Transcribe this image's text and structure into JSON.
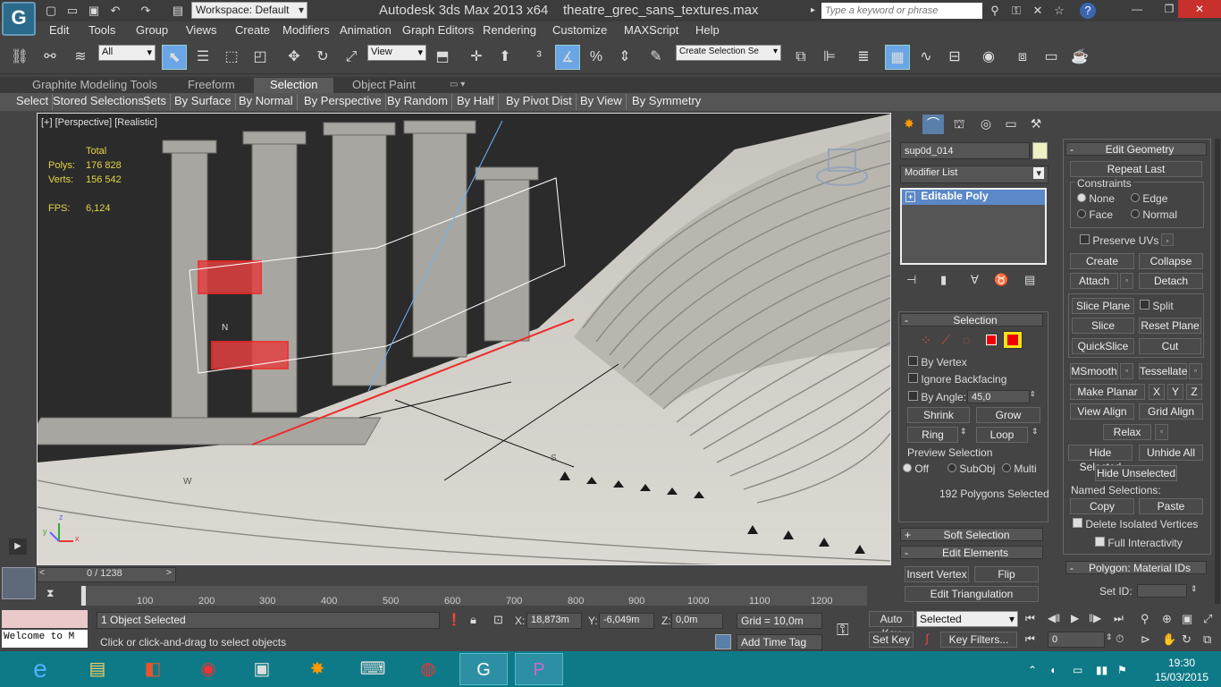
{
  "window": {
    "workspace": "Workspace: Default",
    "app_title": "Autodesk 3ds Max  2013 x64",
    "file_name": "theatre_grec_sans_textures.max",
    "search_placeholder": "Type a keyword or phrase",
    "logo_icon": "3dsmax-logo-icon"
  },
  "menu": [
    "Edit",
    "Tools",
    "Group",
    "Views",
    "Create",
    "Modifiers",
    "Animation",
    "Graph Editors",
    "Rendering",
    "Customize",
    "MAXScript",
    "Help"
  ],
  "toolbar": {
    "filter_value": "All",
    "ref_coord_value": "View",
    "named_selection_placeholder": "Create Selection Se"
  },
  "ribbon": {
    "tabs": [
      "Graphite Modeling Tools",
      "Freeform",
      "Selection",
      "Object Paint"
    ],
    "active_tab": "Selection",
    "subtabs": [
      "Select",
      "Stored Selections",
      "Sets",
      "By Surface",
      "By Normal",
      "By Perspective",
      "By Random",
      "By Half",
      "By Pivot Dist",
      "By View",
      "By Symmetry"
    ]
  },
  "viewport": {
    "label": "[+] [Perspective] [Realistic]",
    "stats_header": "Total",
    "polys_label": "Polys:",
    "polys_value": "176 828",
    "verts_label": "Verts:",
    "verts_value": "156 542",
    "fps_label": "FPS:",
    "fps_value": "6,124",
    "compass_n": "N",
    "compass_w": "W",
    "compass_s": "S",
    "axis_x": "x",
    "axis_y": "y",
    "axis_z": "z"
  },
  "command_panel": {
    "object_name": "sup0d_014",
    "modifier_list": "Modifier List",
    "stack_item": "Editable Poly",
    "selection": {
      "header": "Selection",
      "by_vertex": "By Vertex",
      "ignore_backfacing": "Ignore Backfacing",
      "by_angle": "By Angle:",
      "angle_value": "45,0",
      "shrink": "Shrink",
      "grow": "Grow",
      "ring": "Ring",
      "loop": "Loop",
      "preview_selection": "Preview Selection",
      "preview_off": "Off",
      "preview_subobj": "SubObj",
      "preview_multi": "Multi",
      "status": "192 Polygons Selected"
    },
    "soft_selection": "Soft Selection",
    "edit_elements": "Edit Elements",
    "insert_vertex": "Insert Vertex",
    "flip": "Flip",
    "edit_triangulation": "Edit Triangulation"
  },
  "edit_geometry": {
    "header": "Edit Geometry",
    "repeat_last": "Repeat Last",
    "constraints": "Constraints",
    "c_none": "None",
    "c_edge": "Edge",
    "c_face": "Face",
    "c_normal": "Normal",
    "preserve_uvs": "Preserve UVs",
    "create": "Create",
    "collapse": "Collapse",
    "attach": "Attach",
    "detach": "Detach",
    "slice_plane": "Slice Plane",
    "split": "Split",
    "slice": "Slice",
    "reset_plane": "Reset Plane",
    "quickslice": "QuickSlice",
    "cut": "Cut",
    "msmooth": "MSmooth",
    "tessellate": "Tessellate",
    "make_planar": "Make Planar",
    "x": "X",
    "y": "Y",
    "z": "Z",
    "view_align": "View Align",
    "grid_align": "Grid Align",
    "relax": "Relax",
    "hide_selected": "Hide Selected",
    "unhide_all": "Unhide All",
    "hide_unselected": "Hide Unselected",
    "named_selections": "Named Selections:",
    "copy": "Copy",
    "paste": "Paste",
    "delete_isolated": "Delete Isolated Vertices",
    "full_interactivity": "Full Interactivity",
    "material_ids_header": "Polygon: Material IDs",
    "set_id": "Set ID:"
  },
  "timeline": {
    "frame_counter": "0 / 1238",
    "ticks": [
      "100",
      "200",
      "300",
      "400",
      "500",
      "600",
      "700",
      "800",
      "900",
      "1000",
      "1100",
      "1200"
    ]
  },
  "status": {
    "maxscript_text": "Welcome to M",
    "objects_selected": "1 Object Selected",
    "prompt": "Click or click-and-drag to select objects",
    "x_label": "X:",
    "x_value": "18,873m",
    "y_label": "Y:",
    "y_value": "-6,049m",
    "z_label": "Z:",
    "z_value": "0,0m",
    "grid": "Grid = 10,0m",
    "add_time_tag": "Add Time Tag",
    "auto_key": "Auto Key",
    "set_key": "Set Key",
    "key_mode": "Selected",
    "key_filters": "Key Filters...",
    "frame_value": "0"
  },
  "taskbar": {
    "time": "19:30",
    "date": "15/03/2015"
  }
}
